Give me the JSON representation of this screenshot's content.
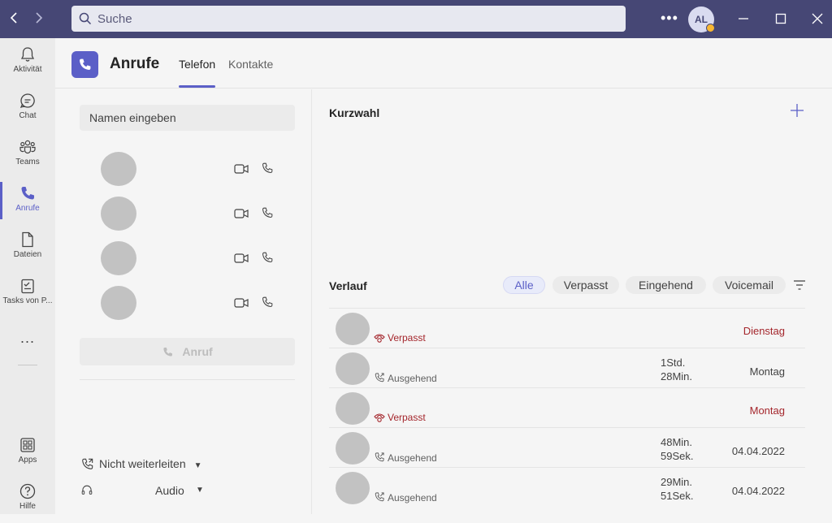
{
  "titlebar": {
    "search_placeholder": "Suche",
    "user_initials": "AL"
  },
  "rail": {
    "items": [
      {
        "label": "Aktivität",
        "icon": "bell-icon"
      },
      {
        "label": "Chat",
        "icon": "chat-icon"
      },
      {
        "label": "Teams",
        "icon": "teams-icon"
      },
      {
        "label": "Anrufe",
        "icon": "phone-icon",
        "active": true
      },
      {
        "label": "Dateien",
        "icon": "file-icon"
      },
      {
        "label": "Tasks von P...",
        "icon": "tasks-icon"
      }
    ],
    "more": "...",
    "apps": {
      "label": "Apps",
      "icon": "apps-icon"
    },
    "help": {
      "label": "Hilfe",
      "icon": "help-icon"
    }
  },
  "header": {
    "title": "Anrufe",
    "tabs": [
      {
        "label": "Telefon",
        "active": true
      },
      {
        "label": "Kontakte",
        "active": false
      }
    ]
  },
  "dialer": {
    "name_placeholder": "Namen eingeben",
    "call_button": "Anruf",
    "forward_label": "Nicht weiterleiten",
    "audio_label": "Audio"
  },
  "speed_dial": {
    "title": "Kurzwahl"
  },
  "history": {
    "title": "Verlauf",
    "filters": [
      {
        "label": "Alle",
        "active": true
      },
      {
        "label": "Verpasst",
        "active": false
      },
      {
        "label": "Eingehend",
        "active": false
      },
      {
        "label": "Voicemail",
        "active": false
      }
    ],
    "rows": [
      {
        "status": "Verpasst",
        "type": "missed",
        "duration_line1": "",
        "duration_line2": "",
        "date": "Dienstag"
      },
      {
        "status": "Ausgehend",
        "type": "outgoing",
        "duration_line1": "1Std.",
        "duration_line2": "28Min.",
        "date": "Montag"
      },
      {
        "status": "Verpasst",
        "type": "missed",
        "duration_line1": "",
        "duration_line2": "",
        "date": "Montag"
      },
      {
        "status": "Ausgehend",
        "type": "outgoing",
        "duration_line1": "48Min.",
        "duration_line2": "59Sek.",
        "date": "04.04.2022"
      },
      {
        "status": "Ausgehend",
        "type": "outgoing",
        "duration_line1": "29Min.",
        "duration_line2": "51Sek.",
        "date": "04.04.2022"
      }
    ]
  },
  "colors": {
    "titlebar": "#464775",
    "accent": "#5b5fc7",
    "missed": "#a4262c"
  }
}
